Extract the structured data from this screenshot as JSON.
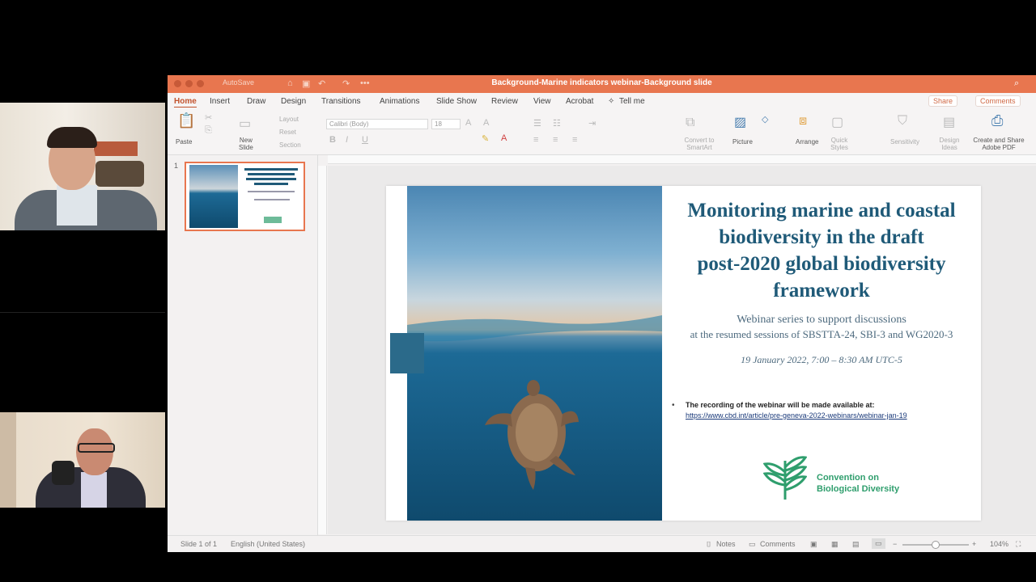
{
  "window": {
    "title": "Background-Marine indicators webinar-Background slide",
    "autosave_label": "AutoSave"
  },
  "tabs": [
    "Home",
    "Insert",
    "Draw",
    "Design",
    "Transitions",
    "Animations",
    "Slide Show",
    "Review",
    "View",
    "Acrobat",
    "Tell me"
  ],
  "share_label": "Share",
  "comments_label": "Comments",
  "ribbon": {
    "paste": "Paste",
    "new_slide": "New\nSlide",
    "layout": "Layout",
    "reset": "Reset",
    "section": "Section",
    "font": "Calibri (Body)",
    "font_size": "18",
    "convert": "Convert to SmartArt",
    "picture": "Picture",
    "arrange": "Arrange",
    "quick_styles": "Quick Styles",
    "sensitivity": "Sensitivity",
    "design_ideas": "Design Ideas",
    "create_share": "Create and Share Adobe PDF"
  },
  "thumbnail": {
    "number": "1"
  },
  "slide": {
    "title_lines": [
      "Monitoring marine and coastal",
      "biodiversity in the draft",
      "post-2020 global biodiversity",
      "framework"
    ],
    "subtitle_lines": [
      "Webinar series to support discussions",
      "at the resumed sessions of SBSTTA-24, SBI-3 and WG2020-3"
    ],
    "date": "19 January 2022, 7:00 – 8:30 AM UTC-5",
    "bullet": "•",
    "recording_text": "The recording of the webinar will be made available at:",
    "recording_link": "https://www.cbd.int/article/pre-geneva-2022-webinars/webinar-jan-19",
    "logo_lines": [
      "Convention on",
      "Biological Diversity"
    ]
  },
  "status": {
    "slide_of": "Slide 1 of 1",
    "language": "English (United States)",
    "notes": "Notes",
    "comments": "Comments",
    "zoom": "104%"
  },
  "colors": {
    "accent": "#e8764f",
    "slide_title": "#1f5a78",
    "cbd_green": "#2f9e6d"
  }
}
